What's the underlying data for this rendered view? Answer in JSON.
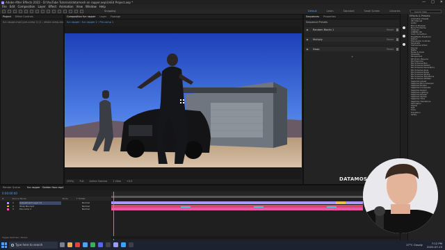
{
  "window": {
    "title": "Adobe After Effects 2022 - D:\\YouTube Tutorials\\datamosh on rapper.aep\\UnEd Project.aep *",
    "controls": [
      "—",
      "□",
      "✕"
    ]
  },
  "menu": [
    "File",
    "Edit",
    "Composition",
    "Layer",
    "Effect",
    "Animation",
    "View",
    "Window",
    "Help"
  ],
  "toolbar": {
    "snapping_label": "Snapping",
    "workspaces": [
      "Default",
      "Learn",
      "Standard",
      "Small Screen",
      "Libraries",
      "Motion",
      "Paint"
    ],
    "active_workspace": "Default",
    "search_placeholder": "Search Help"
  },
  "project_panel": {
    "tabs": [
      "Project",
      "Effect Controls"
    ],
    "subtitle": "fun rapper.mp4 (pre-comp 2) (1 - whole comp.aep)"
  },
  "composition_panel": {
    "tabs": [
      "Composition fun rapper",
      "Layer",
      "Footage"
    ],
    "breadcrumb": "fun rapper  ›  fun rapper 2  ›  Pre-comp 1",
    "footer": [
      "(50%)",
      "Full",
      "Active Camera",
      "1 View",
      "+0.0"
    ]
  },
  "effect_panel": {
    "tabs": [
      "Sequences",
      "Properties"
    ],
    "header": "Sequence Presets",
    "rows": [
      {
        "name": "Random Blocks 1",
        "reset": "Reset"
      },
      {
        "name": "Multiply",
        "reset": "Reset"
      },
      {
        "name": "Swap",
        "reset": "Reset"
      }
    ]
  },
  "effects_list": {
    "title": "Effects & Presets",
    "items": [
      "Animation Presets",
      "3D Channel",
      "Audio",
      "Blur & Sharpen",
      "Boris FX Mocha",
      "Channel",
      "CINEMA 4D",
      "Color Correction",
      "Digieffects FreeForm",
      "Distort",
      "Expression Controls",
      "Generate",
      "Immersive Video",
      "Keying",
      "Matte",
      "Noise & Grain",
      "Obsolete",
      "Perspective",
      "RE:Vision Plug-ins",
      "RG Trapcode",
      "RG Universe Blur",
      "RG Universe Distort",
      "RG Universe Generators",
      "RG Universe Glow",
      "RG Universe Noise",
      "RG Universe Stylize",
      "RG Universe Transitions",
      "RG Universe Utilities",
      "Sapphire Adjust",
      "Sapphire Blur+Sharpen",
      "Sapphire Builder",
      "Sapphire Composite",
      "Sapphire Distort",
      "Sapphire Lighting",
      "Sapphire Render",
      "Sapphire Stylize",
      "Sapphire Time",
      "Sapphire Transitions",
      "Simulation",
      "Stylize",
      "Text",
      "Time",
      "Transition",
      "Utility"
    ]
  },
  "watermark": "DATAMOSH",
  "timeline": {
    "tabs": [
      "Render Queue",
      "fun rapper · Golden Hour.mp4"
    ],
    "timecode": "0:00:00:00",
    "header": [
      "#",
      "Source Name",
      "Mode",
      "T TrkMat"
    ],
    "layers": [
      {
        "num": "1",
        "name": "[Adjustment Layer 2]",
        "mode": "Normal",
        "color": "#a59cff"
      },
      {
        "num": "2",
        "name": "Wrap Me.mp4",
        "mode": "Normal",
        "color": "#e8b24a"
      },
      {
        "num": "3",
        "name": "Pre-comp 2",
        "mode": "Normal",
        "color": "#e85aa8"
      }
    ],
    "footer": "Toggle Switches / Modes"
  },
  "taskbar": {
    "search_placeholder": "Type here to search",
    "weather": "27°C Cloudy",
    "time": "7:12 PM",
    "date": "2022-07-13"
  }
}
